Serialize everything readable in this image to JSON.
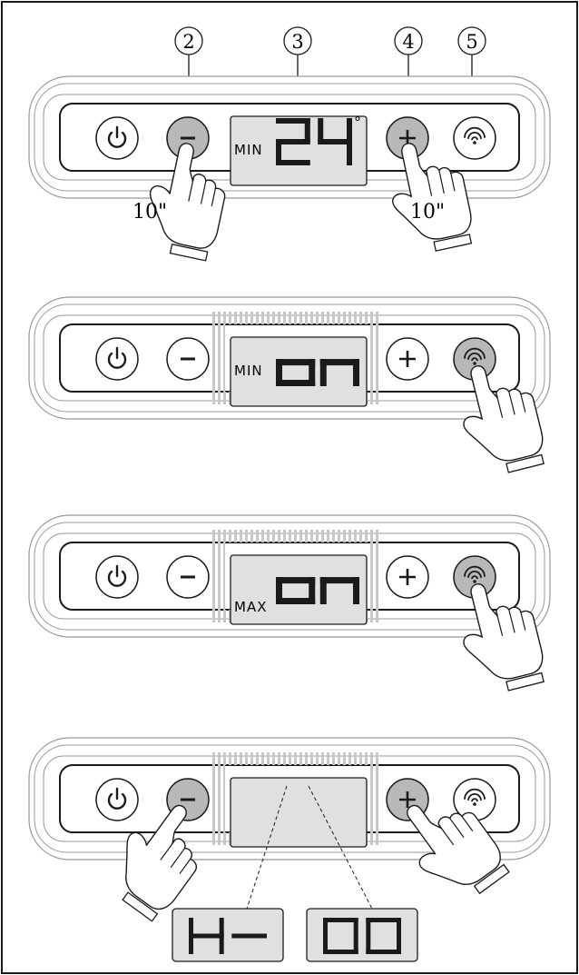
{
  "callouts": [
    "2",
    "3",
    "4",
    "5"
  ],
  "press_duration": "10\"",
  "panels": [
    {
      "mode_label": "MIN",
      "display_value": "24",
      "degree_symbol": "°",
      "highlighted_buttons": [
        "minus",
        "plus"
      ],
      "pressed": [
        "minus",
        "plus"
      ],
      "blinking": false
    },
    {
      "mode_label": "MIN",
      "display_value": "on",
      "highlighted_buttons": [
        "wifi"
      ],
      "pressed": [
        "wifi"
      ],
      "blinking": true
    },
    {
      "mode_label": "MAX",
      "display_value": "on",
      "highlighted_buttons": [
        "wifi"
      ],
      "pressed": [
        "wifi"
      ],
      "blinking": true
    },
    {
      "mode_label": "",
      "display_value": "",
      "highlighted_buttons": [
        "minus",
        "plus"
      ],
      "pressed": [
        "minus",
        "plus"
      ],
      "blinking": true
    }
  ],
  "zoom_displays": [
    "H-",
    "00"
  ],
  "icons": [
    "power-icon",
    "minus-icon",
    "plus-icon",
    "wifi-icon",
    "hand-pointer-icon"
  ],
  "colors": {
    "line": "#1a1a1a",
    "button_active": "#b8b8b8",
    "lcd": "#e0e0e0",
    "blink": "#c8c8c8",
    "frame": "#999999"
  }
}
